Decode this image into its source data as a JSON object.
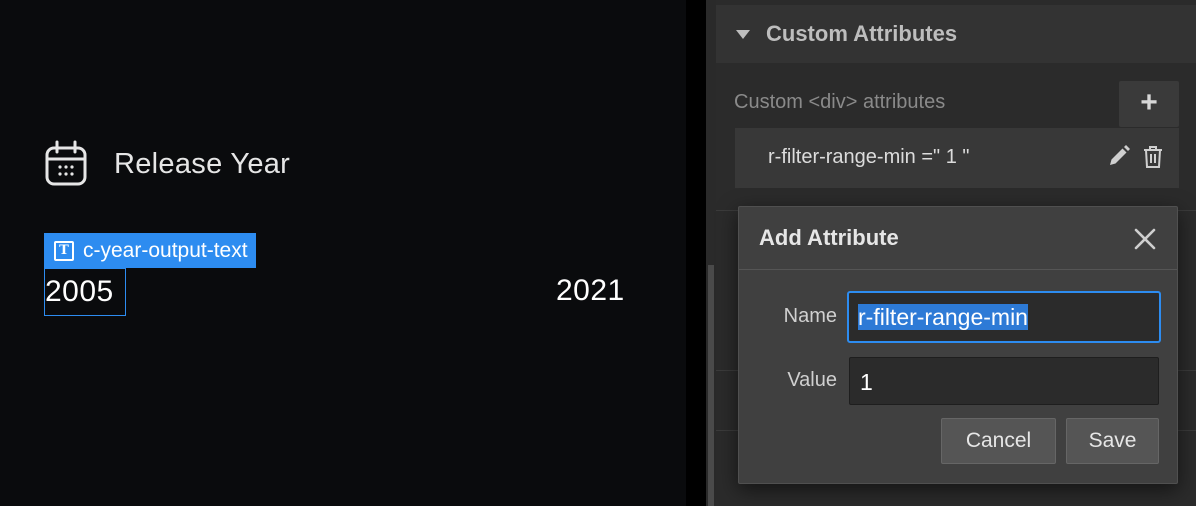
{
  "canvas": {
    "filter_title": "Release Year",
    "selected_element_tag": "c-year-output-text",
    "year_min": "2005",
    "year_max": "2021",
    "icons": {
      "heading": "calendar-icon",
      "tag": "text-element-icon",
      "tag_glyph": "T"
    }
  },
  "panel": {
    "section_title": "Custom Attributes",
    "attrs_label": "Custom <div> attributes",
    "add_button": "+",
    "attribute_row": "r-filter-range-min =\" 1 \"",
    "icons": {
      "section": "caret-down-icon",
      "edit": "pencil-icon",
      "delete": "trash-icon"
    }
  },
  "modal": {
    "title": "Add Attribute",
    "name_label": "Name",
    "name_value": "r-filter-range-min",
    "value_label": "Value",
    "value_value": "1",
    "cancel_label": "Cancel",
    "save_label": "Save",
    "icons": {
      "close": "close-icon"
    }
  },
  "colors": {
    "accent": "#2d8cf0",
    "canvas_bg": "#0a0b0d",
    "panel_bg": "#2b2b2b",
    "modal_bg": "#404040"
  }
}
